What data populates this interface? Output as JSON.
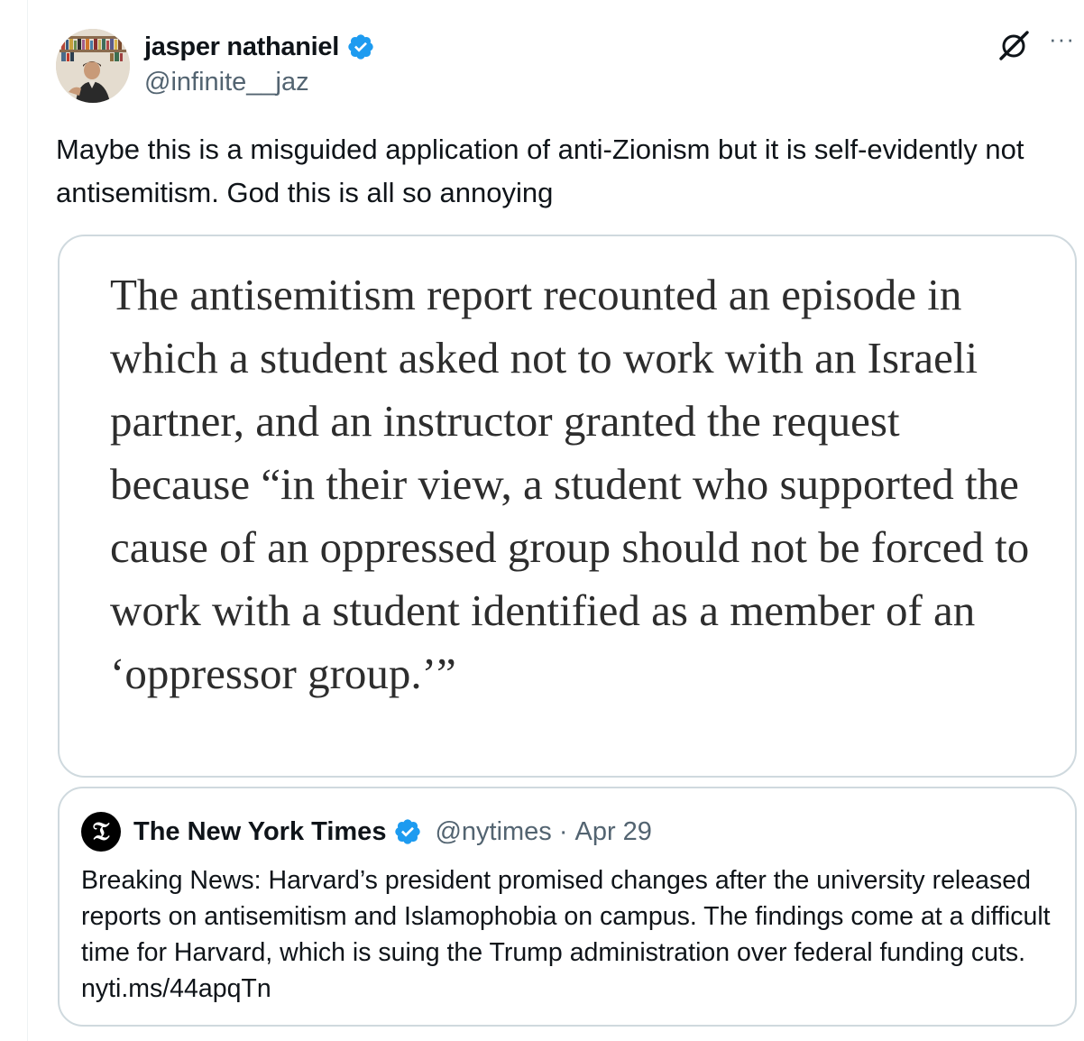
{
  "author": {
    "display_name": "jasper nathaniel",
    "handle": "@infinite__jaz",
    "verified_icon": "verified-badge-icon",
    "avatar_icon": "avatar"
  },
  "actions": {
    "grok_icon": "grok-icon",
    "more_label": "···"
  },
  "tweet": {
    "text": "Maybe this is a misguided application of anti-Zionism but it is self-evidently not antisemitism. God this is all so annoying"
  },
  "media": {
    "quote_text": "The antisemitism report recounted an episode in which a student asked not to work with an Israeli partner, and an instructor granted the request because “in their view, a student who supported the cause of an oppressed group should not be forced to work with a student identified as a member of an ‘oppressor group.’”"
  },
  "quoted_tweet": {
    "logo_glyph": "𝔗",
    "display_name": "The New York Times",
    "handle": "@nytimes",
    "separator": "·",
    "date": "Apr 29",
    "text": "Breaking News: Harvard’s president promised changes after the university released reports on antisemitism and Islamophobia on campus. The findings come at a difficult time for Harvard, which is suing the Trump administration over federal funding cuts. nyti.ms/44apqTn"
  },
  "colors": {
    "verified_blue": "#1d9bf0",
    "secondary_text": "#536471",
    "border": "#cfd9de"
  }
}
